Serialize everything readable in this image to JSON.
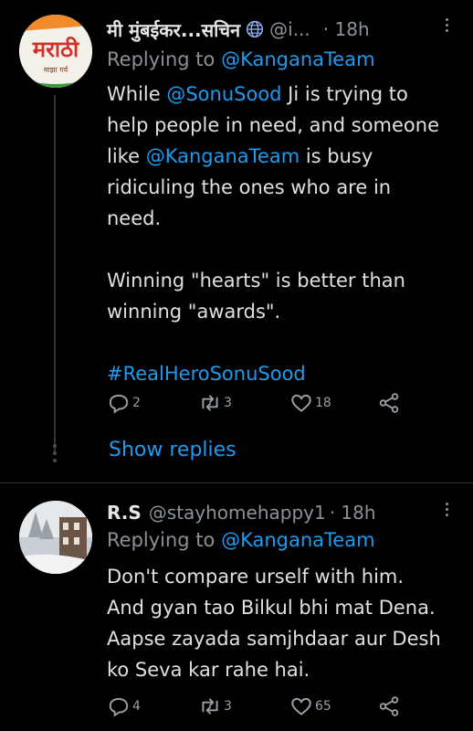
{
  "tweets": [
    {
      "name": "मी मुंबईकर...सचिन",
      "handle": "@i...",
      "time": "· 18h",
      "replying_prefix": "Replying to ",
      "replying_to": "@KanganaTeam",
      "avatar_text": "मराठी",
      "avatar_subtext": "माझा गर्व",
      "body": {
        "l1a": "While ",
        "l1m": "@SonuSood",
        "l1b": " Ji is trying to",
        "l2": "help people in need, and someone",
        "l3a": "like ",
        "l3m": "@KanganaTeam",
        "l3b": " is busy",
        "l4": "ridiculing the ones who are in",
        "l5": "need.",
        "p2l1": "Winning \"hearts\" is better than",
        "p2l2": "winning \"awards\".",
        "hashtag": "#RealHeroSonuSood"
      },
      "reply_count": "2",
      "retweet_count": "3",
      "like_count": "18",
      "show_replies": "Show replies"
    },
    {
      "name": "R.S",
      "handle": "@stayhomehappy1",
      "time": "· 18h",
      "replying_prefix": "Replying to ",
      "replying_to": "@KanganaTeam",
      "body": {
        "l1": "Don't compare urself with him.",
        "l2": "And gyan tao Bilkul bhi mat Dena.",
        "l3": "Aapse zayada samjhdaar aur Desh",
        "l4": "ko Seva kar rahe hai."
      },
      "reply_count": "4",
      "retweet_count": "3",
      "like_count": "65"
    }
  ],
  "icons": [
    "globe-icon",
    "more-vertical-icon",
    "reply-icon",
    "retweet-icon",
    "like-icon",
    "share-icon"
  ],
  "colors": {
    "background": "#000000",
    "link": "#1d9bf0",
    "muted": "#8b9197",
    "text": "#e0e0e0"
  }
}
